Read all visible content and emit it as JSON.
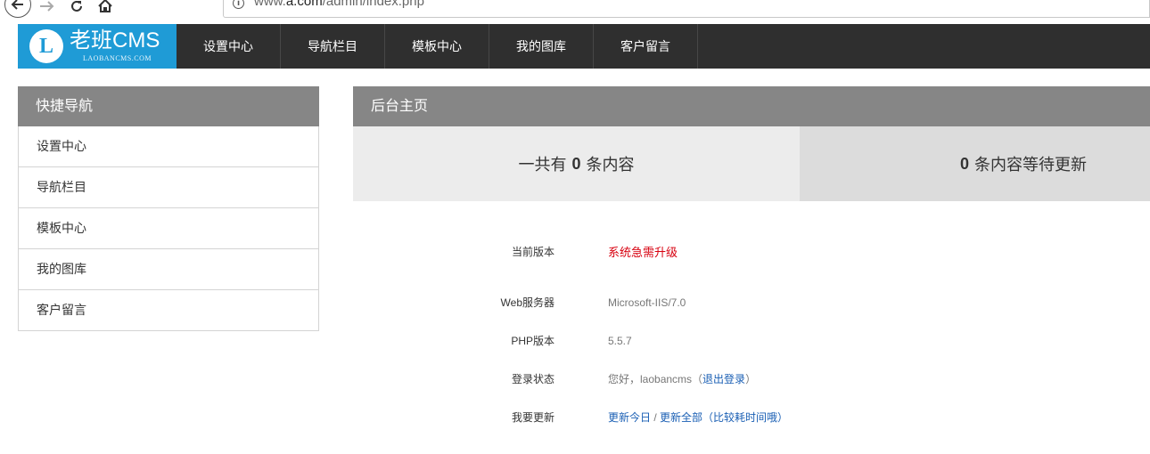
{
  "browser": {
    "url_prefix": "www.",
    "url_domain": "a.com",
    "url_path": "/admin/index.php",
    "info_icon": "i"
  },
  "logo": {
    "letter": "L",
    "title": "老班CMS",
    "subtitle": "LAOBANCMS.COM"
  },
  "topnav": {
    "items": [
      "设置中心",
      "导航栏目",
      "模板中心",
      "我的图库",
      "客户留言"
    ]
  },
  "sidebar": {
    "title": "快捷导航",
    "items": [
      "设置中心",
      "导航栏目",
      "模板中心",
      "我的图库",
      "客户留言"
    ]
  },
  "main": {
    "title": "后台主页",
    "stats": {
      "left_prefix": "一共有",
      "left_count": "0",
      "left_suffix": "条内容",
      "right_count": "0",
      "right_suffix": "条内容等待更新"
    },
    "info": {
      "version_label": "当前版本",
      "version_value": "系统急需升级",
      "server_label": "Web服务器",
      "server_value": "Microsoft-IIS/7.0",
      "php_label": "PHP版本",
      "php_value": "5.5.7",
      "login_label": "登录状态",
      "login_greeting": "您好，laobancms（",
      "login_logout": "退出登录",
      "login_close": "）",
      "update_label": "我要更新",
      "update_today": "更新今日",
      "update_sep": " / ",
      "update_all": "更新全部（比较耗时间哦）"
    }
  },
  "colors": {
    "logo_bg": "#1f9bd6",
    "nav_bg": "#2f2f2f",
    "panel_head": "#868686",
    "alert_red": "#d7000f",
    "link_blue": "#1a5fb4"
  }
}
